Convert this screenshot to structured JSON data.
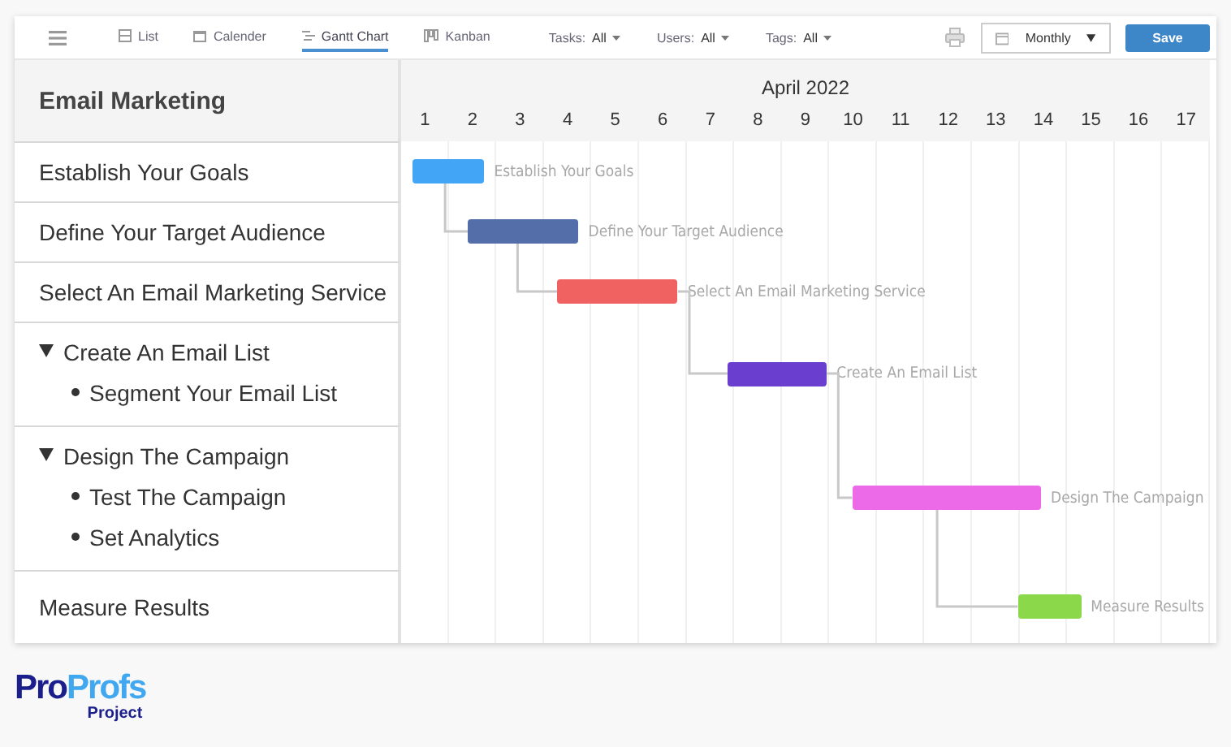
{
  "toolbar": {
    "views": [
      {
        "label": "List",
        "selected": false
      },
      {
        "label": "Calender",
        "selected": false
      },
      {
        "label": "Gantt Chart",
        "selected": true
      },
      {
        "label": "Kanban",
        "selected": false
      }
    ],
    "filters": [
      {
        "label": "Tasks:",
        "value": "All"
      },
      {
        "label": "Users:",
        "value": "All"
      },
      {
        "label": "Tags:",
        "value": "All"
      }
    ],
    "period": "Monthly",
    "save": "Save"
  },
  "board": {
    "title": "Email Marketing",
    "month": "April 2022",
    "days": [
      "1",
      "2",
      "3",
      "4",
      "5",
      "6",
      "7",
      "8",
      "9",
      "10",
      "11",
      "12",
      "13",
      "14",
      "15",
      "16",
      "17"
    ],
    "tasks": [
      {
        "kind": "task",
        "name": "Establish Your Goals",
        "bar": {
          "label": "Establish Your Goals",
          "color": "#42a5f5"
        }
      },
      {
        "kind": "task",
        "name": "Define Your Target Audience",
        "bar": {
          "label": "Define Your Target Audience",
          "color": "#536ea8"
        }
      },
      {
        "kind": "task",
        "name": "Select An Email Marketing Service",
        "bar": {
          "label": "Select An Email Marketing Service",
          "color": "#f06262"
        }
      },
      {
        "kind": "group",
        "name": "Create An Email List",
        "expanded": true,
        "children": [
          "Segment Your Email List"
        ],
        "bar": {
          "label": "Create An Email List",
          "color": "#6a3fd0"
        }
      },
      {
        "kind": "group",
        "name": "Design The Campaign",
        "expanded": true,
        "children": [
          "Test The Campaign",
          "Set Analytics"
        ],
        "bar": {
          "label": "Design The Campaign",
          "color": "#ec6ae8"
        }
      },
      {
        "kind": "task",
        "name": "Measure Results",
        "bar": {
          "label": "Measure Results",
          "color": "#8bd94a"
        }
      }
    ]
  },
  "logo": {
    "name_first": "Pro",
    "name_second": "Profs",
    "product": "Project"
  }
}
